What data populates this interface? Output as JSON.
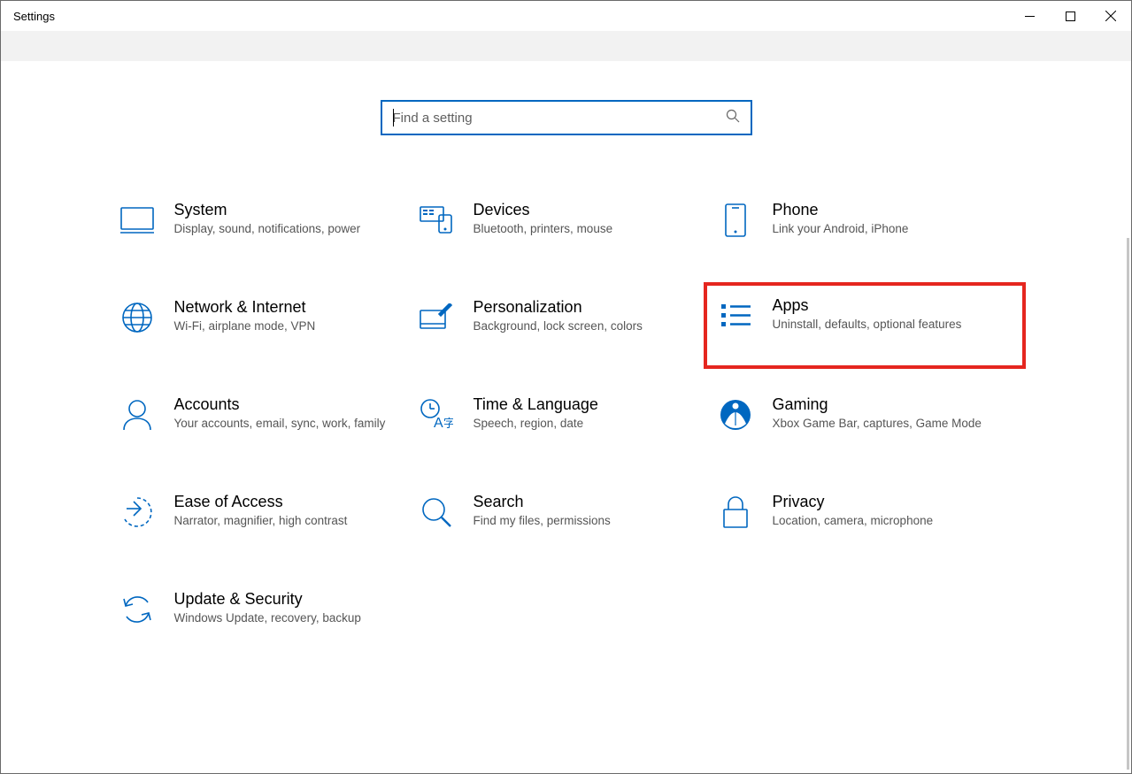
{
  "window": {
    "title": "Settings"
  },
  "search": {
    "placeholder": "Find a setting"
  },
  "categories": [
    {
      "id": "system",
      "title": "System",
      "desc": "Display, sound, notifications, power"
    },
    {
      "id": "devices",
      "title": "Devices",
      "desc": "Bluetooth, printers, mouse"
    },
    {
      "id": "phone",
      "title": "Phone",
      "desc": "Link your Android, iPhone"
    },
    {
      "id": "network",
      "title": "Network & Internet",
      "desc": "Wi-Fi, airplane mode, VPN"
    },
    {
      "id": "personalization",
      "title": "Personalization",
      "desc": "Background, lock screen, colors"
    },
    {
      "id": "apps",
      "title": "Apps",
      "desc": "Uninstall, defaults, optional features",
      "highlighted": true
    },
    {
      "id": "accounts",
      "title": "Accounts",
      "desc": "Your accounts, email, sync, work, family"
    },
    {
      "id": "time",
      "title": "Time & Language",
      "desc": "Speech, region, date"
    },
    {
      "id": "gaming",
      "title": "Gaming",
      "desc": "Xbox Game Bar, captures, Game Mode"
    },
    {
      "id": "ease",
      "title": "Ease of Access",
      "desc": "Narrator, magnifier, high contrast"
    },
    {
      "id": "searchcat",
      "title": "Search",
      "desc": "Find my files, permissions"
    },
    {
      "id": "privacy",
      "title": "Privacy",
      "desc": "Location, camera, microphone"
    },
    {
      "id": "update",
      "title": "Update & Security",
      "desc": "Windows Update, recovery, backup"
    }
  ]
}
